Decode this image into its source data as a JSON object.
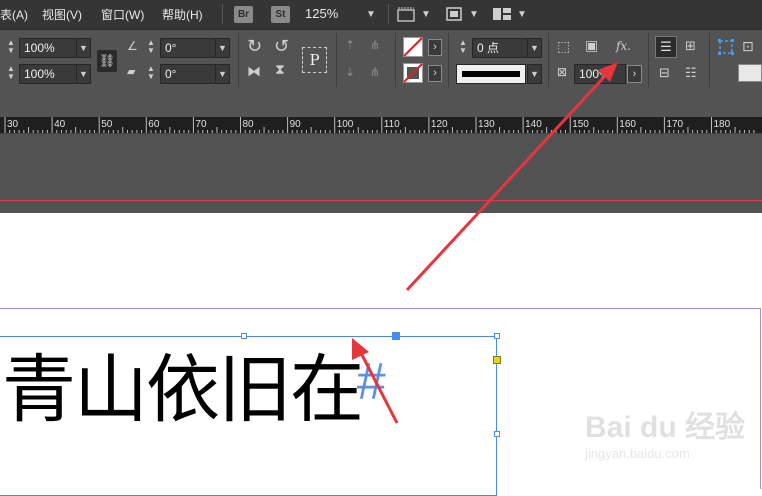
{
  "menubar": {
    "items": [
      "表(A)",
      "视图(V)",
      "窗口(W)",
      "帮助(H)"
    ],
    "apps": [
      "Br",
      "St"
    ],
    "zoom": "125%"
  },
  "control": {
    "scale_x": "100%",
    "scale_y": "100%",
    "rotate": "0°",
    "shear": "0°",
    "stroke_weight": "0 点",
    "opacity": "100%",
    "text_frame_icon": "P",
    "fx_label": "fx."
  },
  "ruler": {
    "labels": [
      "30",
      "40",
      "50",
      "60",
      "70",
      "80",
      "90",
      "100",
      "110",
      "120",
      "130",
      "140",
      "150",
      "160",
      "170",
      "180"
    ]
  },
  "document": {
    "text": "青山依旧在",
    "end_mark": "#"
  },
  "watermark": {
    "brand": "Bai du 经验",
    "sub": "jingyan.baidu.com"
  },
  "colors": {
    "arrow": "#e8343d",
    "selection": "#4a8de8",
    "margin": "#b08cd8"
  }
}
